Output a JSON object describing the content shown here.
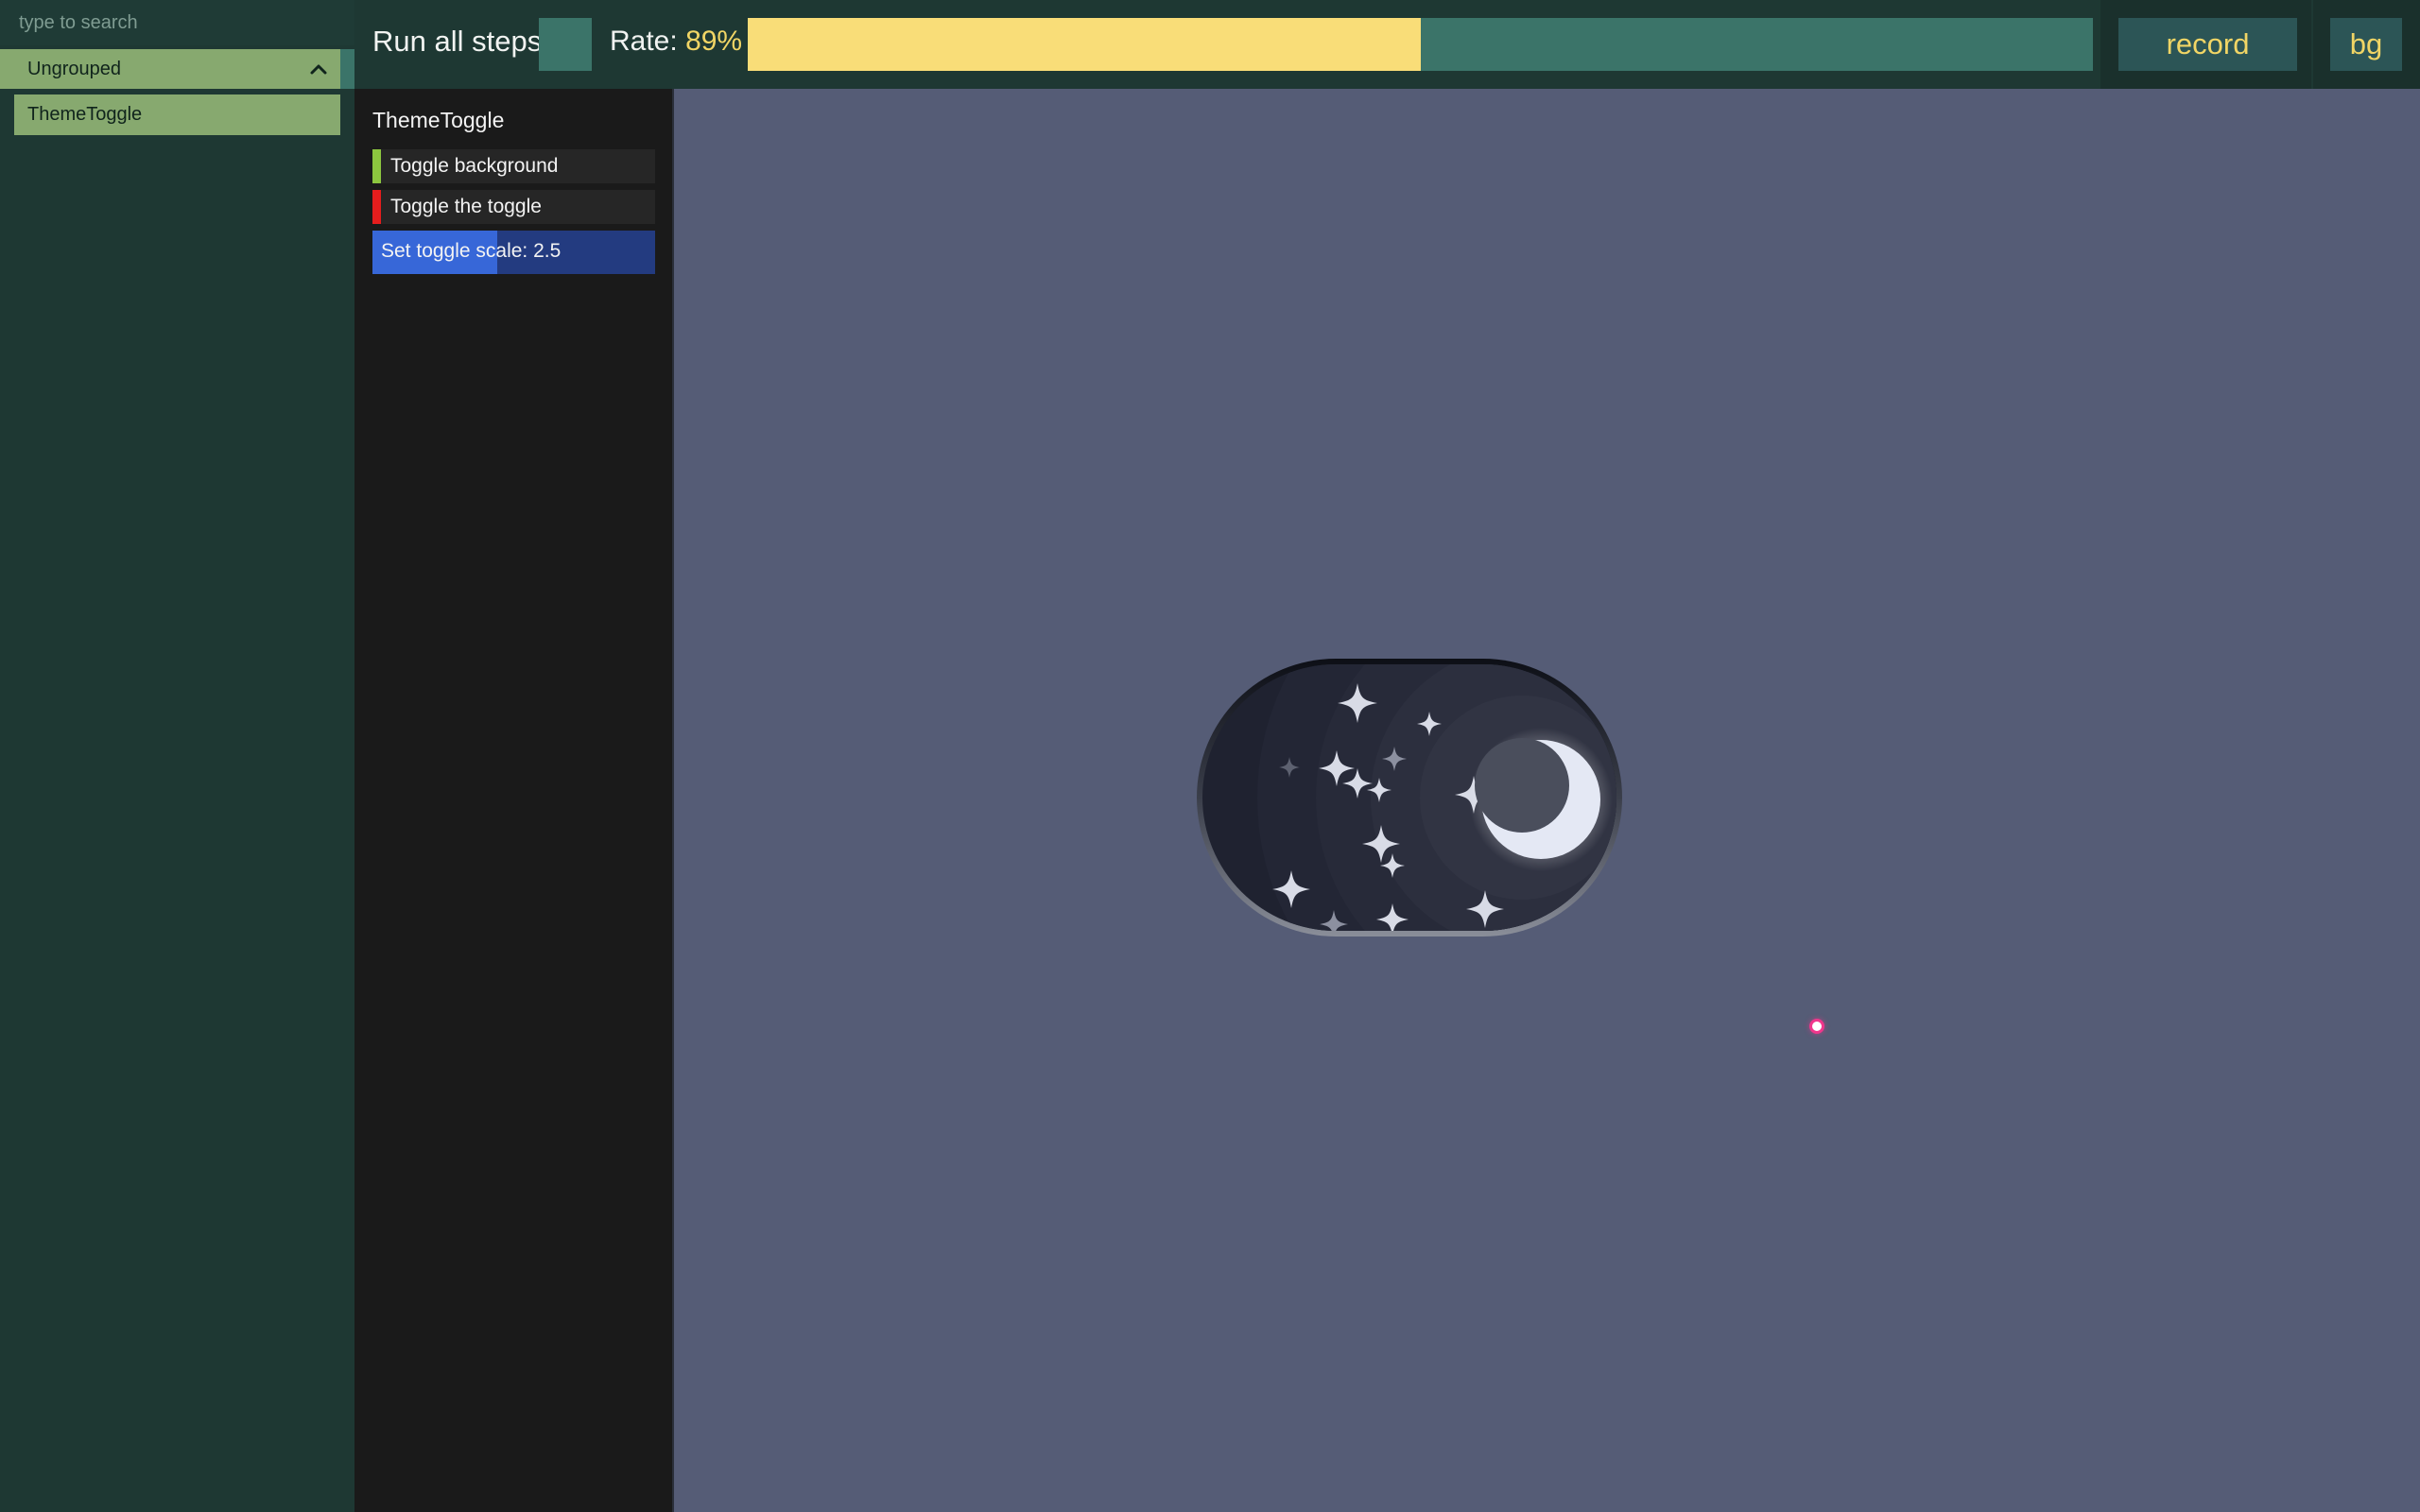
{
  "sidebar": {
    "search_placeholder": "type to search",
    "group": {
      "label": "Ungrouped",
      "icon": "chevron-up-icon",
      "expanded": true
    },
    "stories": [
      {
        "label": "ThemeToggle",
        "selected": true
      }
    ]
  },
  "toolbar": {
    "run_all_label": "Run all steps",
    "rate_label": "Rate:",
    "rate_value": "89%",
    "rate_fraction": 0.89,
    "record_label": "record",
    "bg_label": "bg"
  },
  "steps": {
    "title": "ThemeToggle",
    "items": [
      {
        "label": "Toggle background",
        "marker_color": "#8cc63f"
      },
      {
        "label": "Toggle the toggle",
        "marker_color": "#e51d1d"
      }
    ],
    "slider": {
      "label": "Set toggle scale: 2.5",
      "value": 2.5
    }
  },
  "canvas": {
    "background_color": "#555c76",
    "toggle": {
      "theme": "dark",
      "icon": "moon-icon"
    },
    "pointer": "cursor-dot"
  },
  "colors": {
    "sidebar_bg": "#1e3833",
    "selected_item": "#87a96f",
    "accent_teal": "#3b7469",
    "rate_fill": "#f9dd78",
    "button_text": "#f1d565",
    "step_slider_bg": "#233b80",
    "step_slider_fill": "#3767d8"
  }
}
